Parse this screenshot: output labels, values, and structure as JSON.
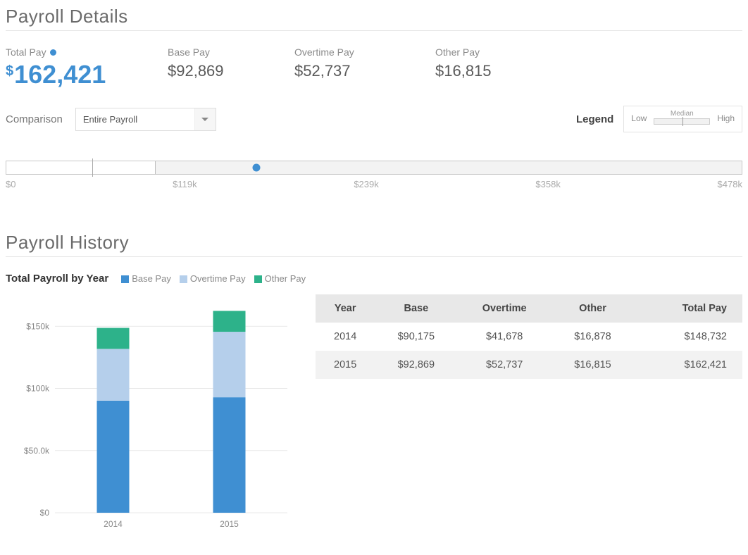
{
  "details": {
    "title": "Payroll Details",
    "total_label": "Total Pay",
    "total_value": "162,421",
    "base_label": "Base Pay",
    "base_value": "$92,869",
    "ot_label": "Overtime Pay",
    "ot_value": "$52,737",
    "other_label": "Other Pay",
    "other_value": "$16,815"
  },
  "comparison": {
    "label": "Comparison",
    "selected": "Entire Payroll",
    "legend_title": "Legend",
    "legend_low": "Low",
    "legend_median": "Median",
    "legend_high": "High",
    "ticks": [
      "$0",
      "$119k",
      "$239k",
      "$358k",
      "$478k"
    ]
  },
  "history": {
    "title": "Payroll History",
    "chart_title": "Total Payroll by Year",
    "leg_base": "Base Pay",
    "leg_ot": "Overtime Pay",
    "leg_other": "Other Pay",
    "table": {
      "headers": [
        "Year",
        "Base",
        "Overtime",
        "Other",
        "Total Pay"
      ],
      "rows": [
        [
          "2014",
          "$90,175",
          "$41,678",
          "$16,878",
          "$148,732"
        ],
        [
          "2015",
          "$92,869",
          "$52,737",
          "$16,815",
          "$162,421"
        ]
      ]
    }
  },
  "chart_data": [
    {
      "type": "range-dot",
      "title": "Total pay vs. entire payroll distribution",
      "xlabel": "Total Pay",
      "xlim": [
        0,
        478000
      ],
      "ticks": [
        0,
        119000,
        239000,
        358000,
        478000
      ],
      "iqr_low": 0,
      "iqr_high": 97000,
      "median": 56000,
      "point": 162421
    },
    {
      "type": "bar",
      "stacked": true,
      "title": "Total Payroll by Year",
      "categories": [
        "2014",
        "2015"
      ],
      "series": [
        {
          "name": "Base Pay",
          "values": [
            90175,
            92869
          ],
          "color": "#3f8fd2"
        },
        {
          "name": "Overtime Pay",
          "values": [
            41678,
            52737
          ],
          "color": "#b5cfeb"
        },
        {
          "name": "Other Pay",
          "values": [
            16878,
            16815
          ],
          "color": "#2db28a"
        }
      ],
      "ylim": [
        0,
        170000
      ],
      "yticks": [
        0,
        50000,
        100000,
        150000
      ],
      "ytick_labels": [
        "$0",
        "$50.0k",
        "$100k",
        "$150k"
      ]
    }
  ]
}
